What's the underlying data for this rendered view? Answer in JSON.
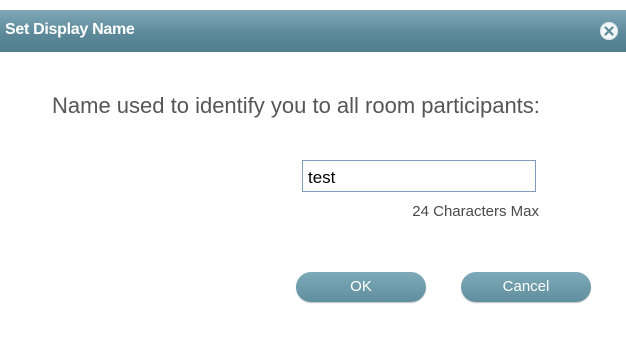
{
  "dialog": {
    "title": "Set Display Name",
    "close_icon": "close-icon"
  },
  "form": {
    "prompt": "Name used to identify you to all room participants:",
    "name_value": "test",
    "hint": "24 Characters Max"
  },
  "buttons": {
    "ok_label": "OK",
    "cancel_label": "Cancel"
  },
  "colors": {
    "titlebar": "#5d8a9a",
    "button": "#6f9dac",
    "input_border": "#7f9db9"
  }
}
